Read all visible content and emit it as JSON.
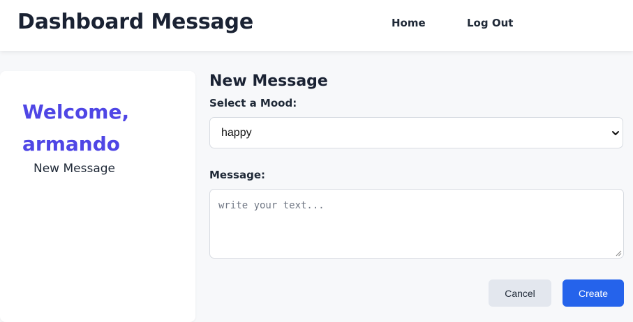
{
  "header": {
    "title": "Dashboard Message",
    "nav": {
      "home": "Home",
      "logout": "Log Out"
    }
  },
  "sidebar": {
    "welcome": "Welcome, armando",
    "link": "New Message"
  },
  "main": {
    "title": "New Message",
    "mood_label": "Select a Mood:",
    "mood_value": "happy",
    "message_label": "Message:",
    "message_placeholder": "write your text...",
    "cancel_label": "Cancel",
    "create_label": "Create"
  },
  "icons": {
    "select": "chevron-down-icon",
    "textarea": "resize-handle-icon"
  },
  "colors": {
    "accent": "#4f46e5",
    "primary_button": "#2563eb",
    "secondary_button": "#e3e7ee"
  }
}
